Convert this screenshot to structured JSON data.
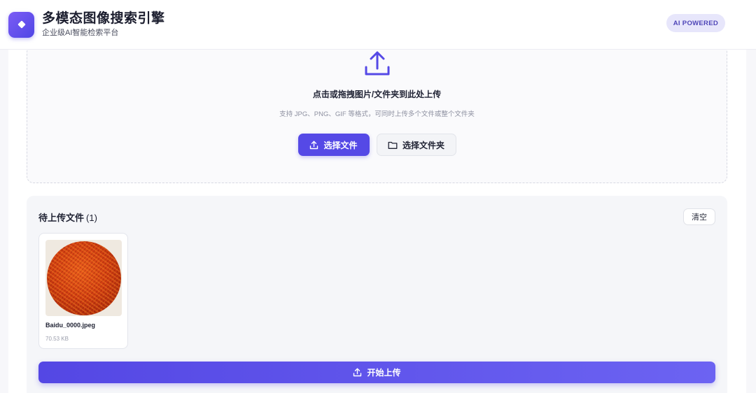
{
  "header": {
    "title": "多模态图像搜索引擎",
    "subtitle": "企业级AI智能检索平台",
    "badge": "AI POWERED",
    "logo_icon": "diamond-icon"
  },
  "dropzone": {
    "title": "点击或拖拽图片/文件夹到此处上传",
    "hint": "支持 JPG、PNG、GIF 等格式，可同时上传多个文件或整个文件夹",
    "icon": "upload-icon",
    "select_files_label": "选择文件",
    "select_folder_label": "选择文件夹"
  },
  "pending": {
    "title": "待上传文件",
    "count": "(1)",
    "clear_label": "清空",
    "files": [
      {
        "name": "Baidu_0000.jpeg",
        "size": "70.53 KB"
      }
    ],
    "start_label": "开始上传"
  },
  "colors": {
    "accent": "#5549e6",
    "badge_bg": "#e7e6fb",
    "badge_text": "#4f46b8"
  }
}
